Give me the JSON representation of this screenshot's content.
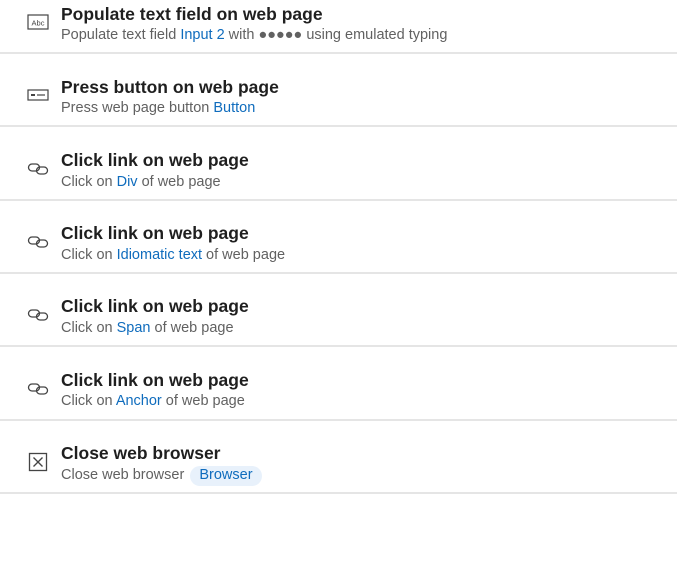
{
  "actions": [
    {
      "icon": "text-field-icon",
      "title": "Populate text field on web page",
      "desc_prefix": "Populate text field ",
      "desc_link": "Input 2",
      "desc_mid": " with ",
      "desc_masked": "●●●●●",
      "desc_suffix": " using emulated typing"
    },
    {
      "icon": "button-icon",
      "title": "Press button on web page",
      "desc_prefix": "Press web page button ",
      "desc_link": "Button"
    },
    {
      "icon": "link-icon",
      "title": "Click link on web page",
      "desc_prefix": "Click on ",
      "desc_link": "Div",
      "desc_suffix": " of web page"
    },
    {
      "icon": "link-icon",
      "title": "Click link on web page",
      "desc_prefix": "Click on ",
      "desc_link": "Idiomatic text",
      "desc_suffix": " of web page"
    },
    {
      "icon": "link-icon",
      "title": "Click link on web page",
      "desc_prefix": "Click on ",
      "desc_link": "Span",
      "desc_suffix": " of web page"
    },
    {
      "icon": "link-icon",
      "title": "Click link on web page",
      "desc_prefix": "Click on ",
      "desc_link": "Anchor",
      "desc_suffix": " of web page"
    },
    {
      "icon": "close-browser-icon",
      "title": "Close web browser",
      "desc_prefix": "Close web browser",
      "desc_pill": "Browser"
    }
  ],
  "colors": {
    "link": "#0f6cbd",
    "pill_background": "#e8f1fb",
    "title": "#1f1f1f",
    "description": "#616161",
    "divider": "#e5e5e5"
  }
}
